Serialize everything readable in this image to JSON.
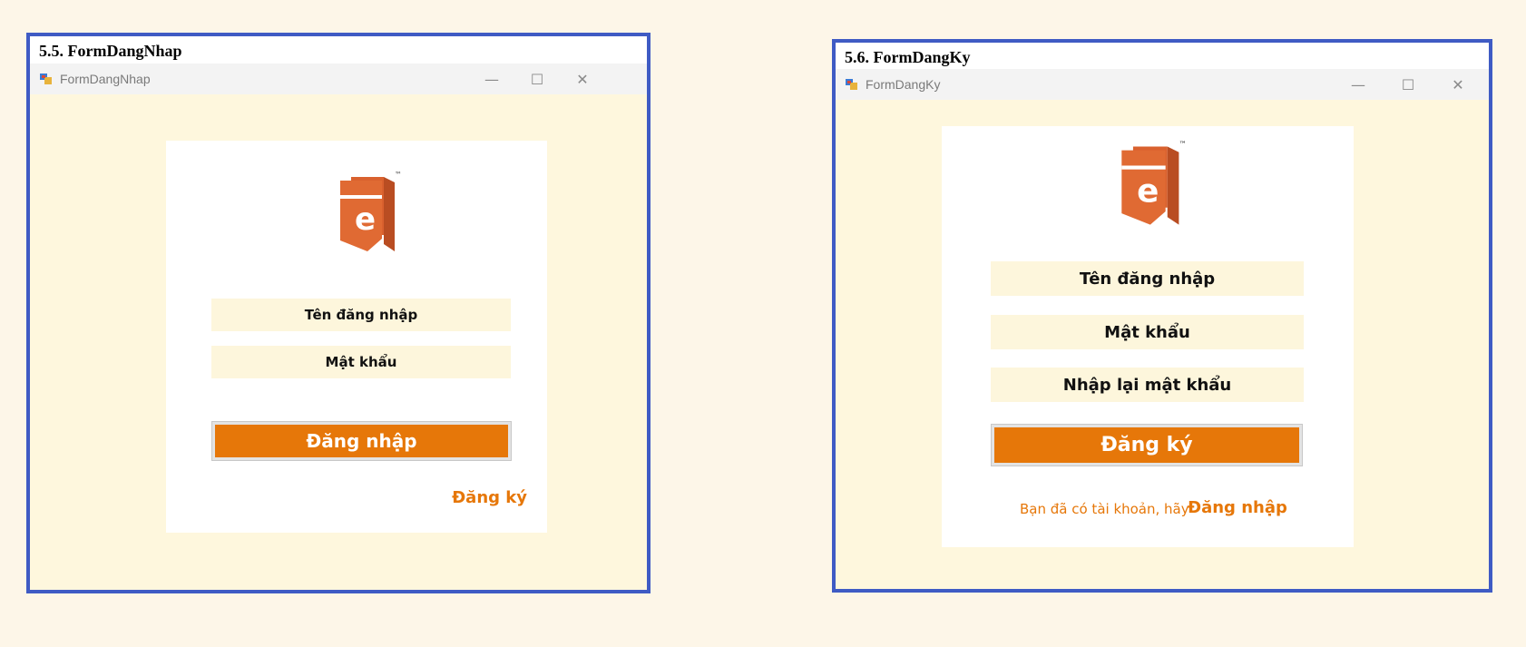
{
  "left_form": {
    "section_title": "5.5. FormDangNhap",
    "window_title": "FormDangNhap",
    "username_placeholder": "Tên đăng nhập",
    "password_placeholder": "Mật khẩu",
    "login_button": "Đăng nhập",
    "register_link": "Đăng ký"
  },
  "right_form": {
    "section_title": "5.6. FormDangKy",
    "window_title": "FormDangKy",
    "username_placeholder": "Tên đăng nhập",
    "password_placeholder": "Mật khẩu",
    "confirm_placeholder": "Nhập lại mật khẩu",
    "register_button": "Đăng ký",
    "hint_text": "Bạn đã có tài khoản, hãy",
    "login_link": "Đăng nhập"
  },
  "window_controls": {
    "minimize": "—",
    "maximize": "☐",
    "close": "✕"
  },
  "logo": {
    "letter": "e",
    "trademark": "™"
  },
  "colors": {
    "accent": "#e67709",
    "frame_border": "#3f5bc4",
    "form_background": "#fef7dd",
    "field_background": "#fdf6dc",
    "logo": "#d9612e"
  },
  "icons": [
    "app-icon",
    "minimize-icon",
    "maximize-icon",
    "close-icon",
    "ebook-logo-icon"
  ]
}
